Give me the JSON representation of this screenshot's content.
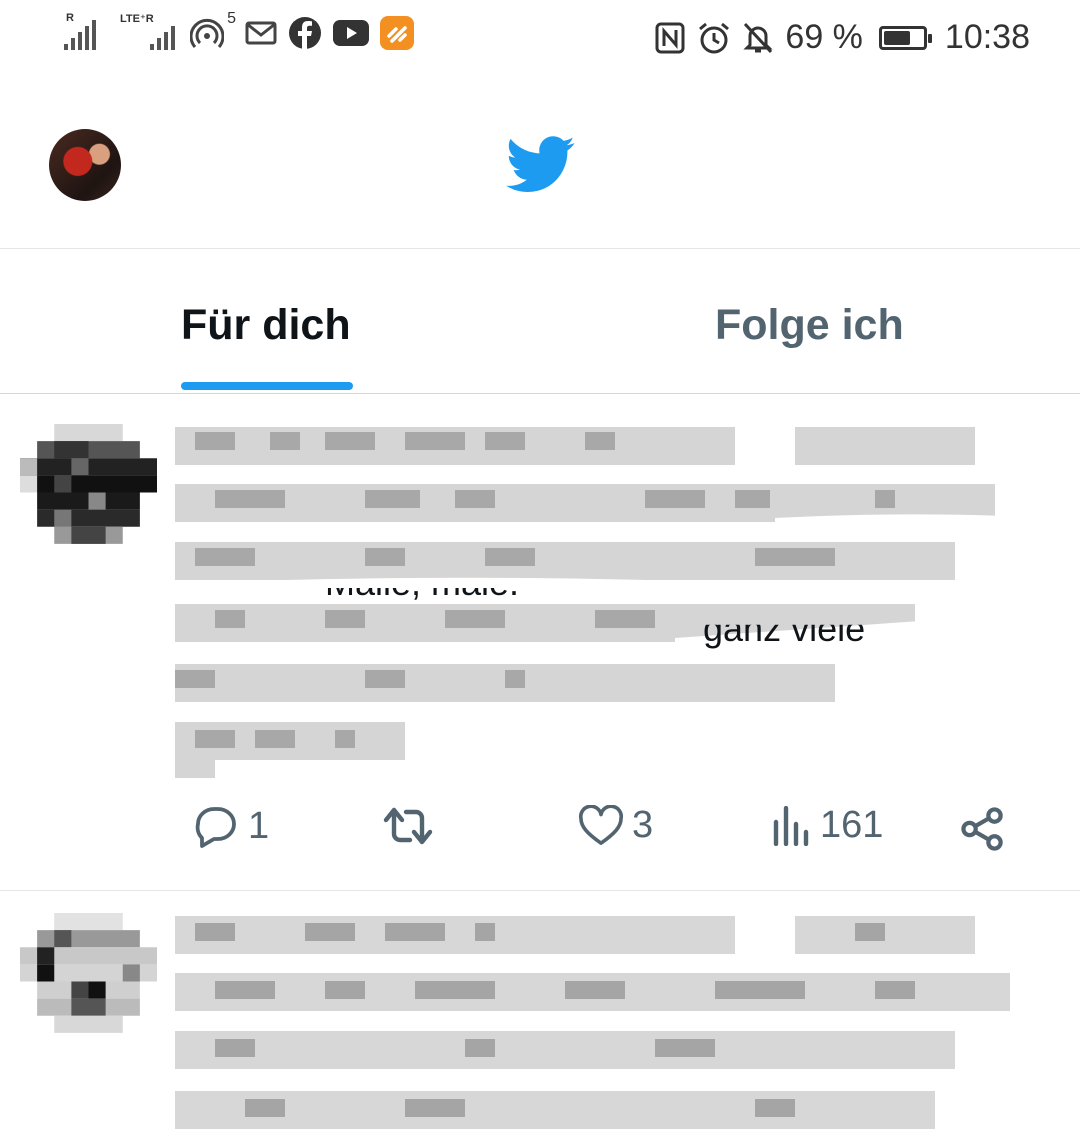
{
  "status_bar": {
    "left_icons": [
      "signal-r-icon",
      "signal-lte-icon",
      "hotspot-icon",
      "mail-icon",
      "facebook-icon",
      "youtube-icon",
      "app-icon"
    ],
    "signal1_tag": "R",
    "signal2_tag": "LTE⁺R",
    "hotspot_count": "5",
    "battery_percent": "69 %",
    "battery_level": 0.69,
    "time": "10:38",
    "right_icons": [
      "nfc-icon",
      "alarm-icon",
      "bell-muted-icon",
      "battery-icon"
    ]
  },
  "header": {
    "avatar": "profile-avatar",
    "logo": "twitter-bird-icon",
    "logo_color": "#1d9bf0"
  },
  "tabs": [
    {
      "label": "Für dich",
      "active": true
    },
    {
      "label": "Folge ich",
      "active": false
    }
  ],
  "accent_color": "#1d9bf0",
  "tweets": [
    {
      "text_fragments": [
        "Maile, male.",
        "ganz viele"
      ],
      "actions": {
        "reply_count": "1",
        "retweet_count": "",
        "like_count": "3",
        "views_count": "161"
      }
    },
    {
      "text_fragments": []
    }
  ]
}
